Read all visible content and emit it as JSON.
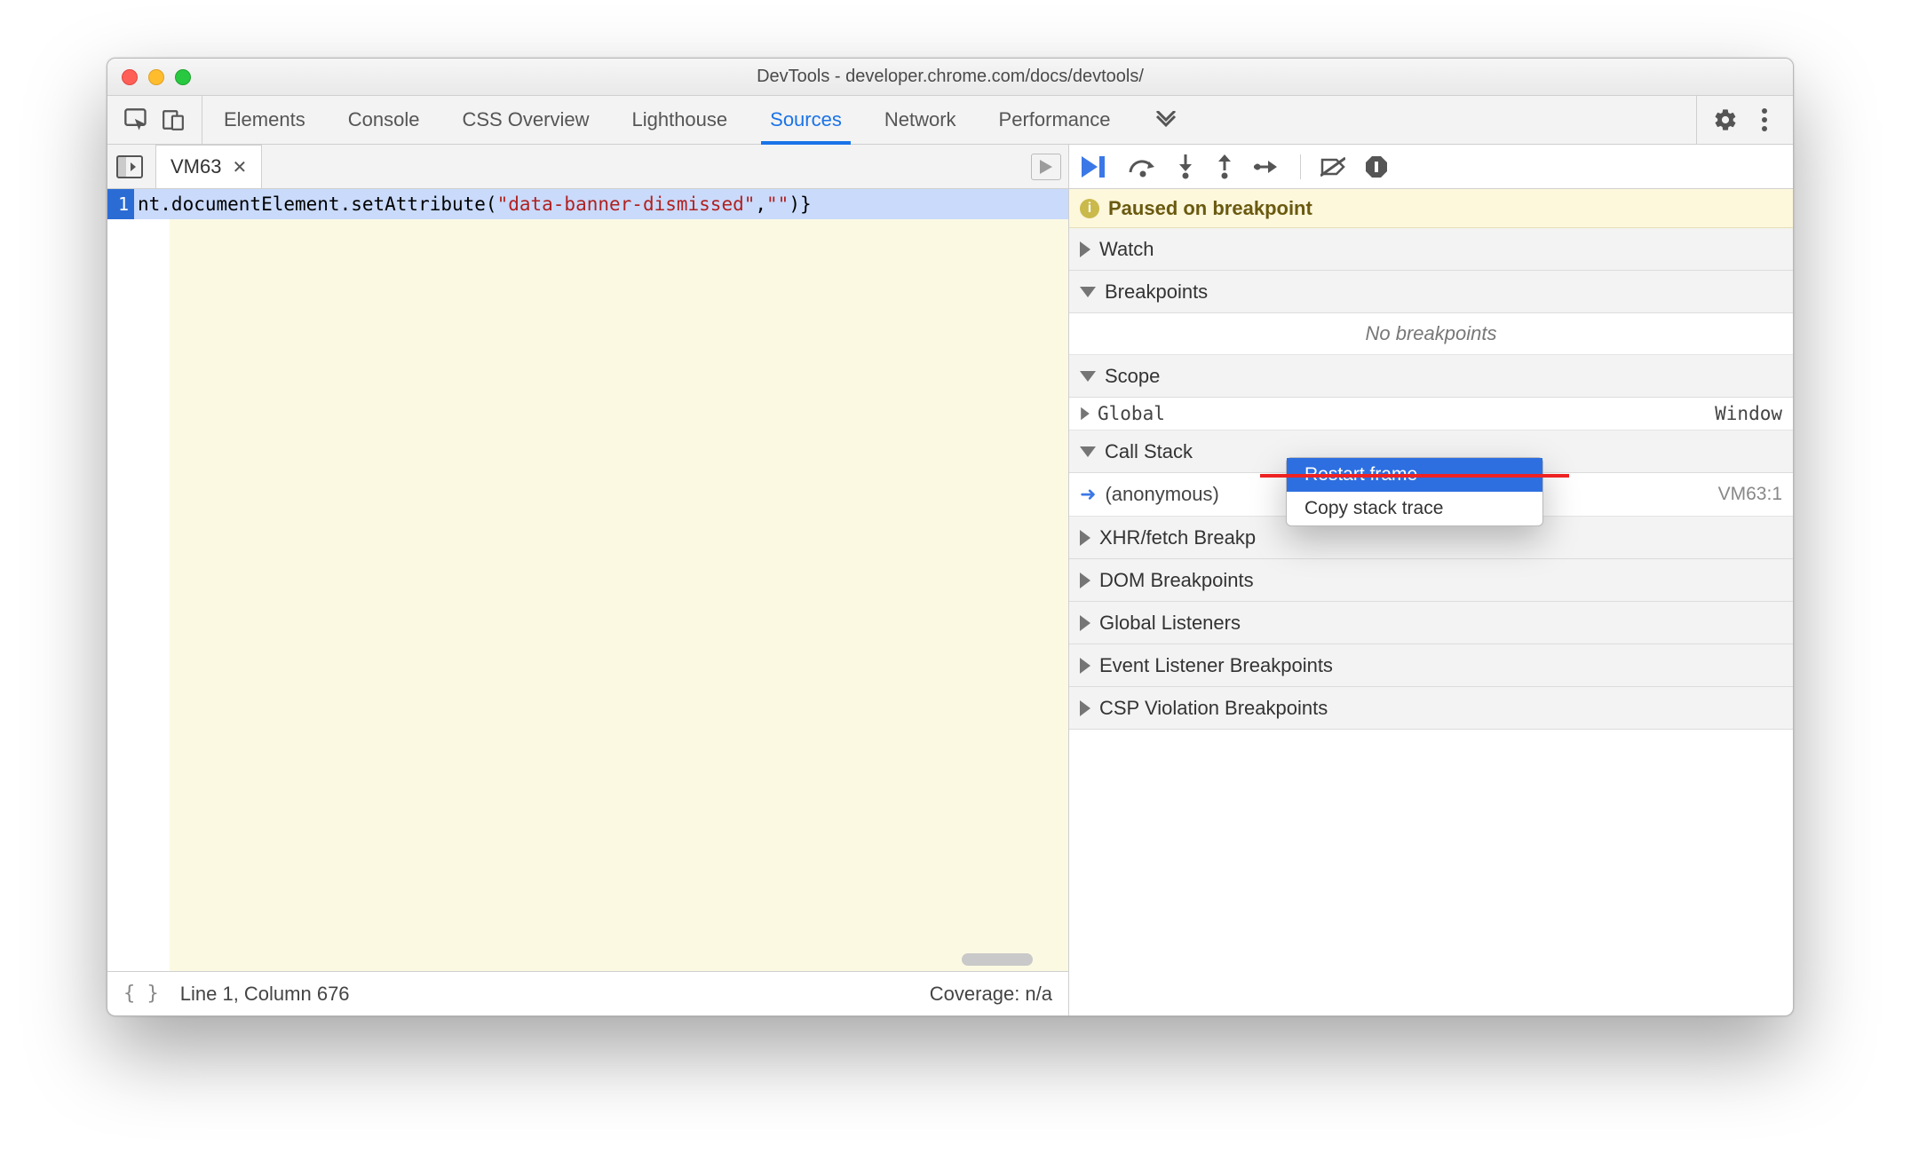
{
  "titlebar": {
    "title": "DevTools - developer.chrome.com/docs/devtools/"
  },
  "tabs": {
    "items": [
      "Elements",
      "Console",
      "CSS Overview",
      "Lighthouse",
      "Sources",
      "Network",
      "Performance"
    ],
    "activeIndex": 4
  },
  "sourceTab": {
    "name": "VM63"
  },
  "code": {
    "lineNumber": "1",
    "prefix": "nt.documentElement.setAttribute(",
    "string1": "\"data-banner-dismissed\"",
    "comma": ",",
    "string2": "\"\"",
    "suffix": ")}"
  },
  "statusbar": {
    "cursor": "Line 1, Column 676",
    "coverage": "Coverage: n/a"
  },
  "debug": {
    "pausedLabel": "Paused on breakpoint",
    "sections": {
      "watch": "Watch",
      "breakpoints": "Breakpoints",
      "noBreakpoints": "No breakpoints",
      "scope": "Scope",
      "scopeGlobal": "Global",
      "scopeGlobalValue": "Window",
      "callStack": "Call Stack",
      "callStackFrame": "(anonymous)",
      "callStackLoc": "VM63:1",
      "xhr": "XHR/fetch Breakp",
      "dom": "DOM Breakpoints",
      "globalListeners": "Global Listeners",
      "eventListeners": "Event Listener Breakpoints",
      "csp": "CSP Violation Breakpoints"
    }
  },
  "contextMenu": {
    "items": [
      "Restart frame",
      "Copy stack trace"
    ],
    "selectedIndex": 0
  }
}
